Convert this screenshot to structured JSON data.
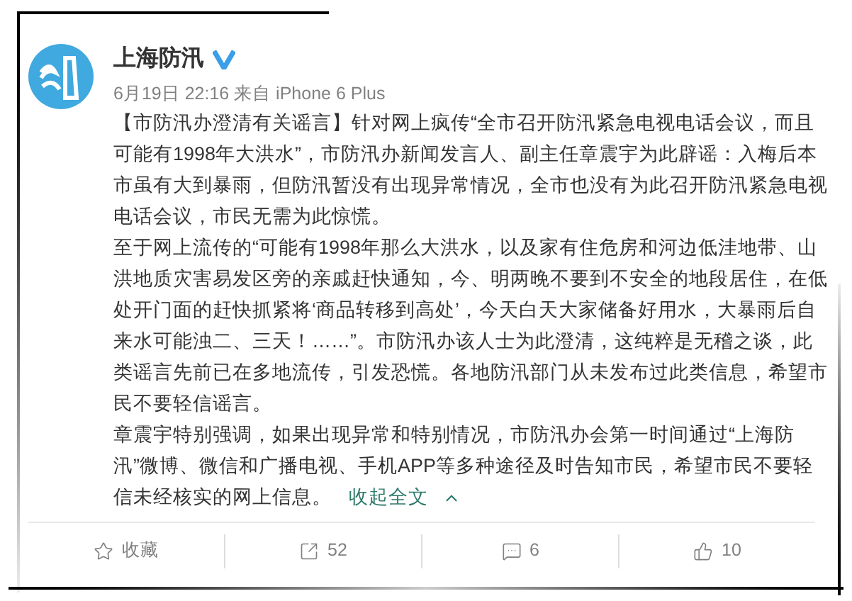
{
  "post": {
    "author": "上海防汛",
    "verified": true,
    "meta": "6月19日 22:16 来自 iPhone 6 Plus",
    "paragraphs": [
      "【市防汛办澄清有关谣言】针对网上疯传“全市召开防汛紧急电视电话会议，而且可能有1998年大洪水”，市防汛办新闻发言人、副主任章震宇为此辟谣：入梅后本市虽有大到暴雨，但防汛暂没有出现异常情况，全市也没有为此召开防汛紧急电视电话会议，市民无需为此惊慌。",
      "至于网上流传的“可能有1998年那么大洪水，以及家有住危房和河边低洼地带、山洪地质灾害易发区旁的亲戚赶快通知，今、明两晚不要到不安全的地段居住，在低处开门面的赶快抓紧将‘商品转移到高处’，今天白天大家储备好用水，大暴雨后自来水可能浊二、三天！……”。市防汛办该人士为此澄清，这纯粹是无稽之谈，此类谣言先前已在多地流传，引发恐慌。各地防汛部门从未发布过此类信息，希望市民不要轻信谣言。",
      "章震宇特别强调，如果出现异常和特别情况，市防汛办会第一时间通过“上海防汛”微博、微信和广播电视、手机APP等多种途径及时告知市民，希望市民不要轻信未经核实的网上信息。"
    ],
    "collapse_link": "收起全文"
  },
  "actions": [
    {
      "kind": "favorite",
      "label": "收藏"
    },
    {
      "kind": "repost",
      "label": "52"
    },
    {
      "kind": "comment",
      "label": "6"
    },
    {
      "kind": "like",
      "label": "10"
    }
  ]
}
